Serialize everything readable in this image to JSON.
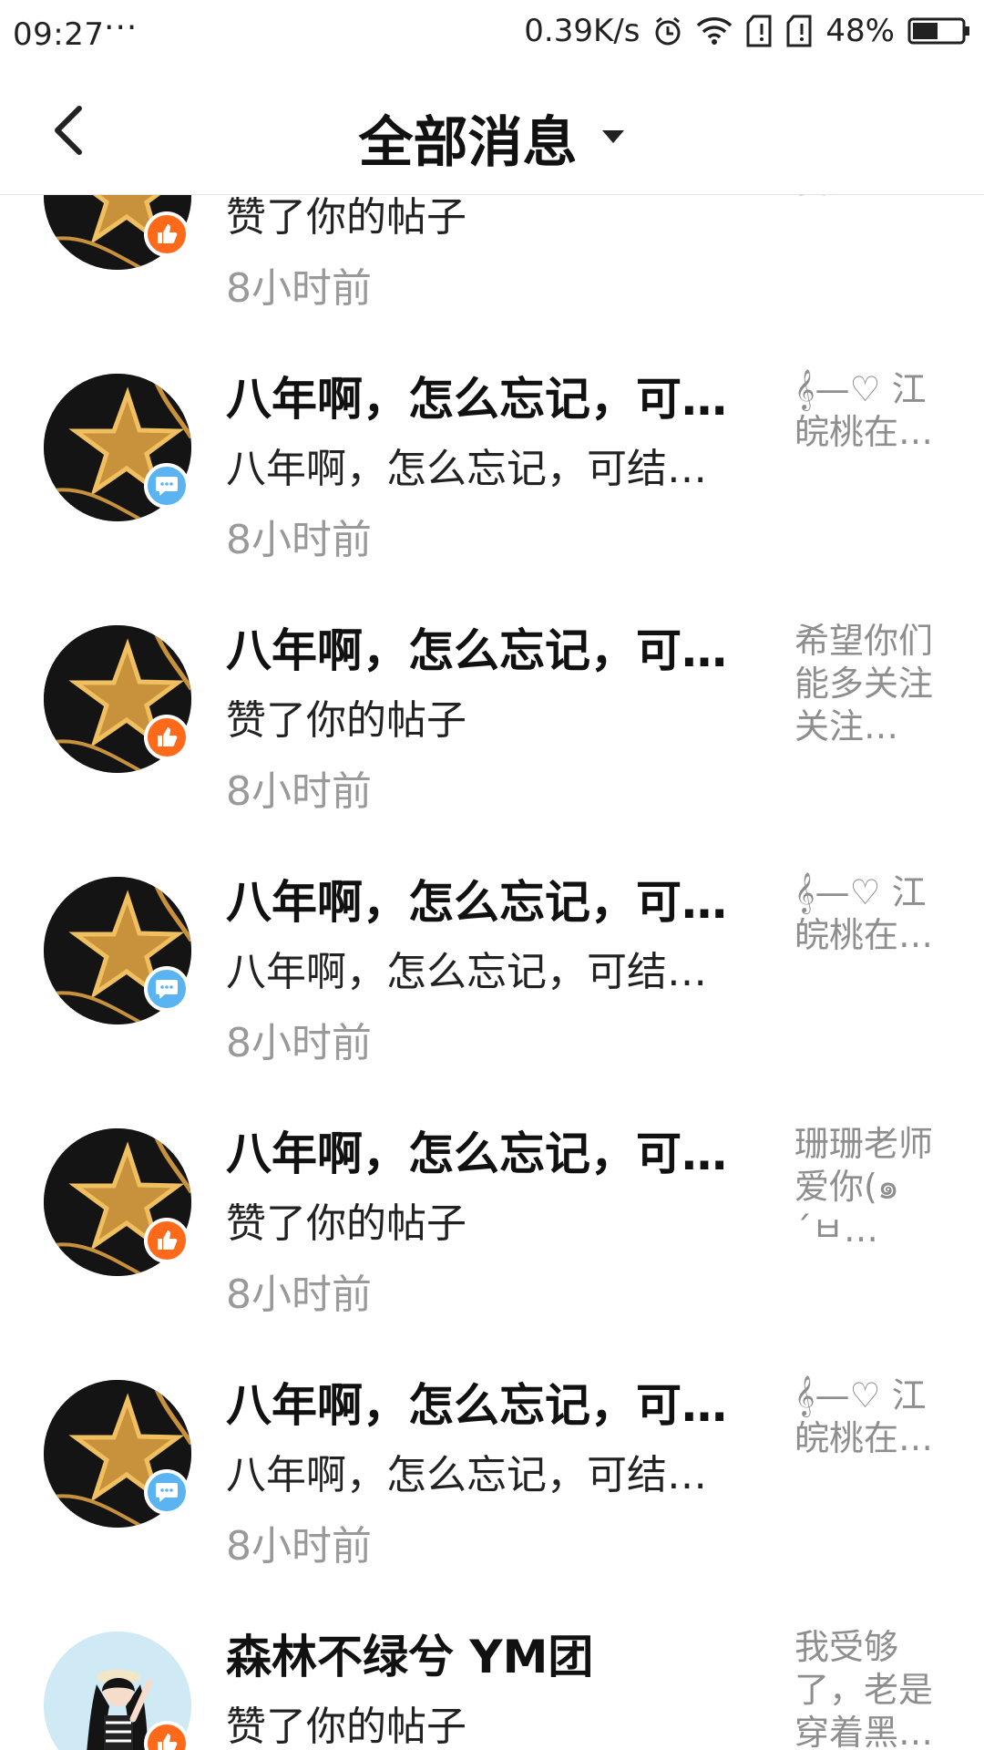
{
  "status_bar": {
    "time": "09:27",
    "dots": "···",
    "network_speed": "0.39K/s",
    "battery_percent": "48%",
    "icons": [
      "alarm-icon",
      "wifi-icon",
      "sim1-icon",
      "sim2-icon",
      "battery-icon"
    ]
  },
  "header": {
    "title": "全部消息",
    "back_icon": "chevron-left-icon",
    "dropdown_icon": "caret-down-icon"
  },
  "colors": {
    "like_badge": "#ff6a1a",
    "comment_badge": "#5bb4f2",
    "time_text": "#999999",
    "quote_text": "#8e8e8e"
  },
  "notifications": [
    {
      "name": "",
      "action": "赞了你的帖子",
      "time": "8小时前",
      "quote": "班老师,我超…",
      "badge": "like",
      "avatar": "star-avatar"
    },
    {
      "name": "八年啊，怎么忘记，可…",
      "action": "八年啊，怎么忘记，可结…",
      "time": "8小时前",
      "quote": "𝄞—♡ 江皖桃在…",
      "badge": "comment",
      "avatar": "star-avatar"
    },
    {
      "name": "八年啊，怎么忘记，可…",
      "action": "赞了你的帖子",
      "time": "8小时前",
      "quote": "希望你们能多关注关注…",
      "badge": "like",
      "avatar": "star-avatar"
    },
    {
      "name": "八年啊，怎么忘记，可…",
      "action": "八年啊，怎么忘记，可结…",
      "time": "8小时前",
      "quote": "𝄞—♡ 江皖桃在…",
      "badge": "comment",
      "avatar": "star-avatar"
    },
    {
      "name": "八年啊，怎么忘记，可…",
      "action": "赞了你的帖子",
      "time": "8小时前",
      "quote": "珊珊老师爱你(๑´ㅂ…",
      "badge": "like",
      "avatar": "star-avatar"
    },
    {
      "name": "八年啊，怎么忘记，可…",
      "action": "八年啊，怎么忘记，可结…",
      "time": "8小时前",
      "quote": "𝄞—♡ 江皖桃在…",
      "badge": "comment",
      "avatar": "star-avatar"
    },
    {
      "name": "森林不绿兮 YM团",
      "action": "赞了你的帖子",
      "time": "",
      "quote": "我受够了，老是穿着黑…",
      "badge": "like",
      "avatar": "anime-girl-avatar"
    }
  ]
}
